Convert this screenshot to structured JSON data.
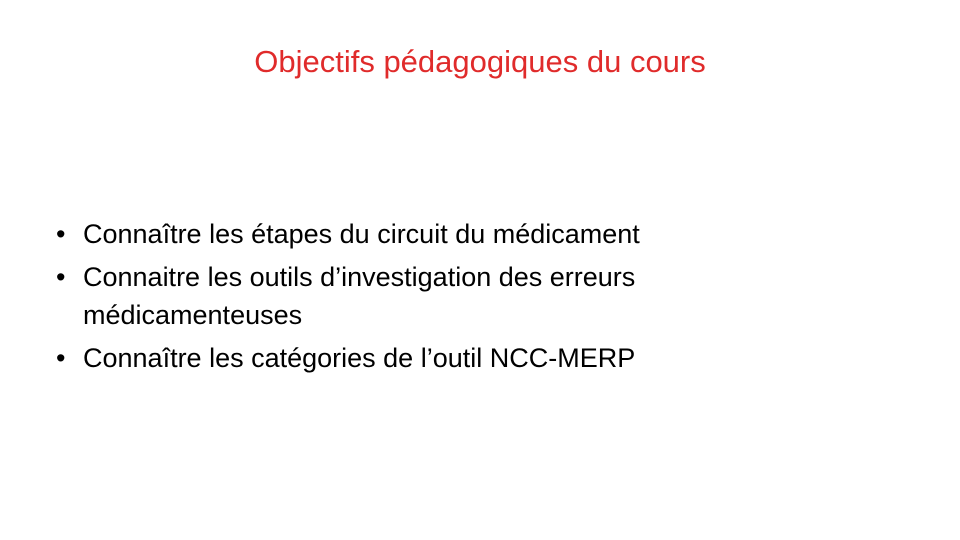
{
  "slide": {
    "title": "Objectifs pédagogiques du cours",
    "title_color": "#e02b2b",
    "bullet_symbol": "•",
    "bullets": [
      "Connaître les étapes du circuit du médicament",
      "Connaitre les outils d’investigation des erreurs médicamenteuses",
      "Connaître les catégories de l’outil NCC-MERP"
    ]
  }
}
